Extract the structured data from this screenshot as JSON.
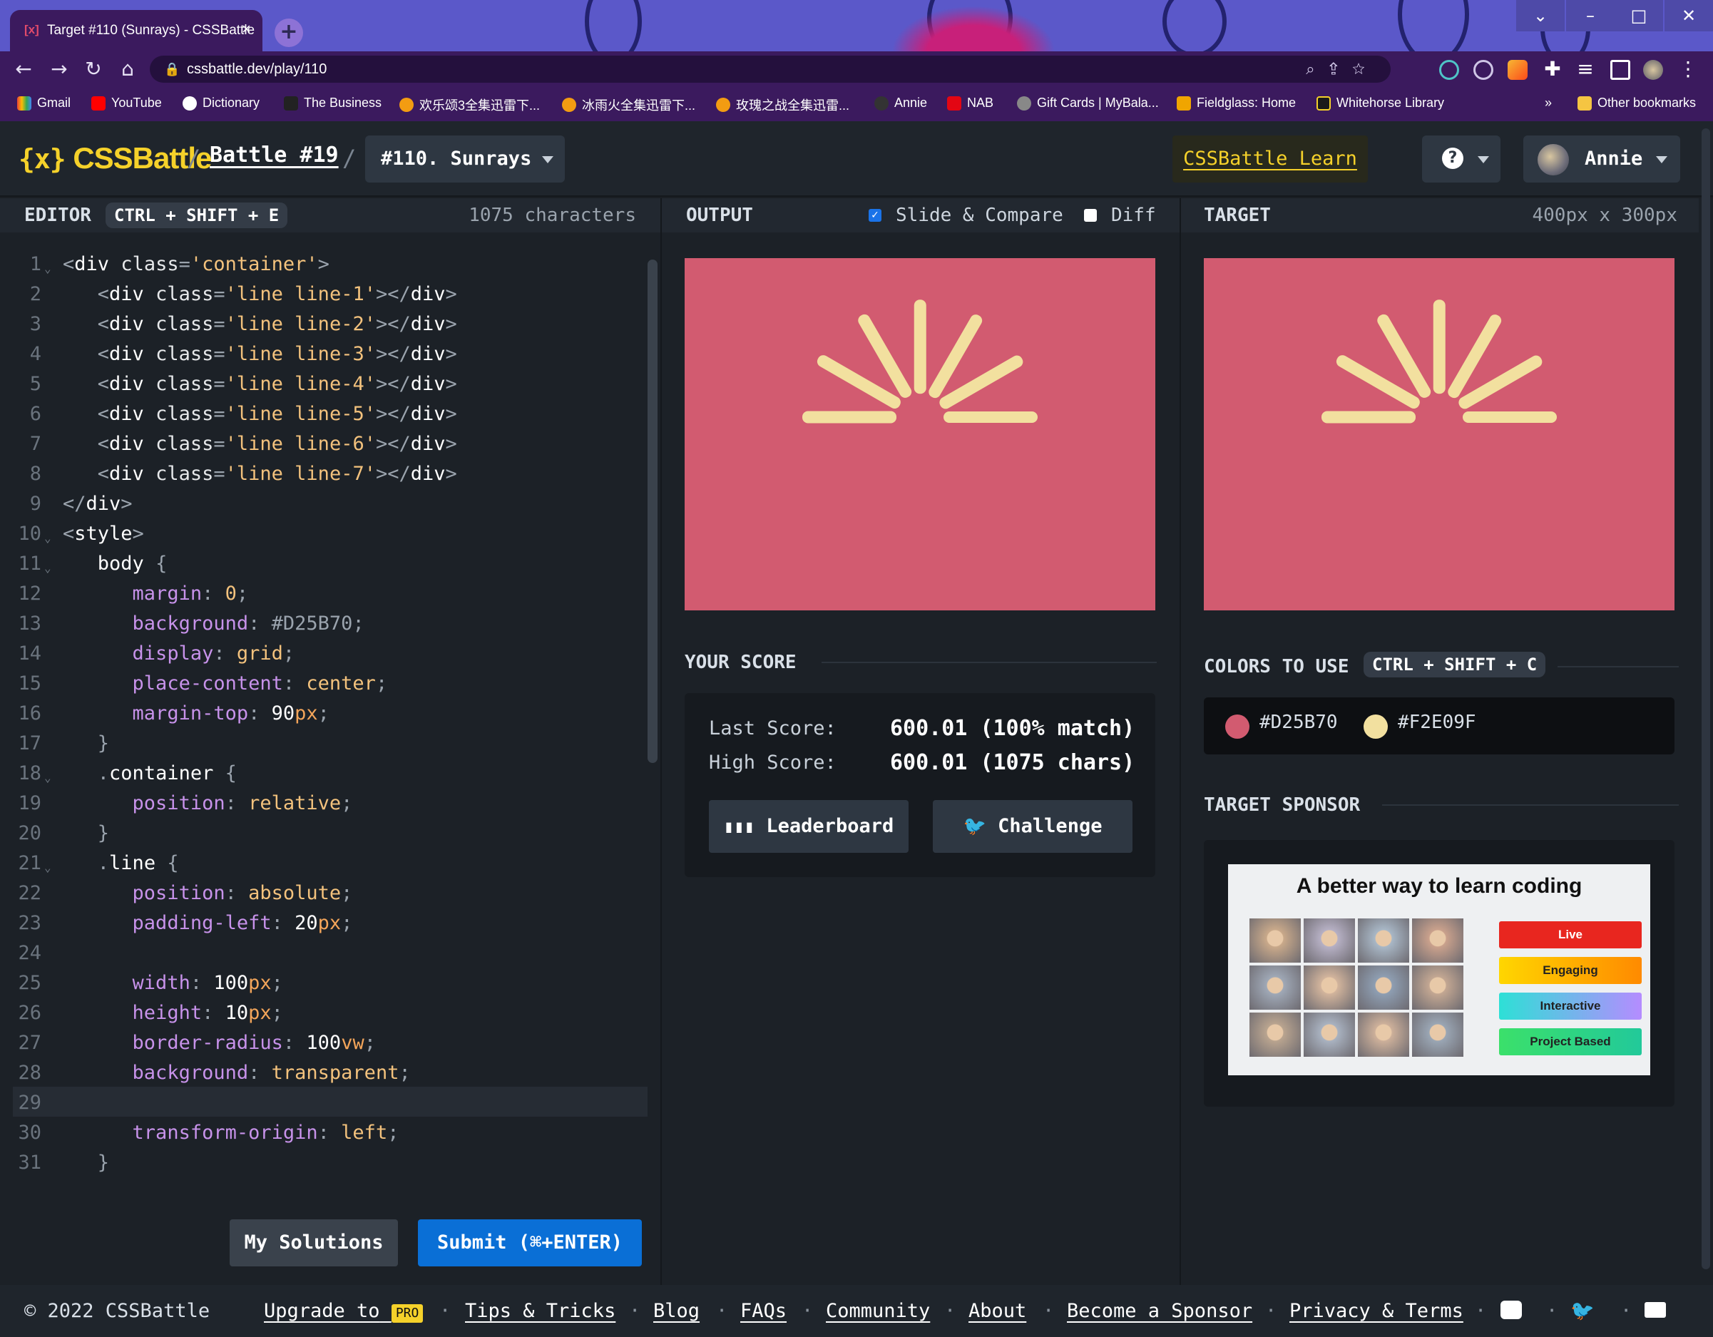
{
  "browser": {
    "tab_title": "Target #110 (Sunrays) - CSSBattle",
    "tab_icon": "[x]",
    "url": "cssbattle.dev/play/110",
    "bookmarks": [
      "Gmail",
      "YouTube",
      "Dictionary",
      "The Business",
      "欢乐颂3全集迅雷下...",
      "冰雨火全集迅雷下...",
      "玫瑰之战全集迅雷...",
      "Annie",
      "NAB",
      "Gift Cards | MyBala...",
      "Fieldglass: Home",
      "Whitehorse Library"
    ],
    "overflow": "»",
    "other_bookmarks": "Other bookmarks"
  },
  "header": {
    "logo": "CSSBattle",
    "logo_brackets": "{x}",
    "sep": "/",
    "battle_link": "Battle #19",
    "target_select": "#110. Sunrays",
    "learn_link": "CSSBattle Learn",
    "help_icon": "?",
    "user_name": "Annie"
  },
  "editor": {
    "label": "EDITOR",
    "shortcut": "CTRL + SHIFT + E",
    "char_count": "1075 characters",
    "my_solutions": "My Solutions",
    "submit": "Submit (⌘+ENTER)"
  },
  "code_lines": [
    {
      "n": "1",
      "t": "<div class='container'>"
    },
    {
      "n": "2",
      "t": "  <div class='line line-1'></div>"
    },
    {
      "n": "3",
      "t": "  <div class='line line-2'></div>"
    },
    {
      "n": "4",
      "t": "  <div class='line line-3'></div>"
    },
    {
      "n": "5",
      "t": "  <div class='line line-4'></div>"
    },
    {
      "n": "6",
      "t": "  <div class='line line-5'></div>"
    },
    {
      "n": "7",
      "t": "  <div class='line line-6'></div>"
    },
    {
      "n": "8",
      "t": "  <div class='line line-7'></div>"
    },
    {
      "n": "9",
      "t": "</div>"
    },
    {
      "n": "10",
      "t": "<style>"
    },
    {
      "n": "11",
      "t": "  body {"
    },
    {
      "n": "12",
      "t": "    margin: 0;"
    },
    {
      "n": "13",
      "t": "    background: #D25B70;"
    },
    {
      "n": "14",
      "t": "    display: grid;"
    },
    {
      "n": "15",
      "t": "    place-content: center;"
    },
    {
      "n": "16",
      "t": "    margin-top: 90px;"
    },
    {
      "n": "17",
      "t": "  }"
    },
    {
      "n": "18",
      "t": "  .container {"
    },
    {
      "n": "19",
      "t": "    position: relative;"
    },
    {
      "n": "20",
      "t": "  }"
    },
    {
      "n": "21",
      "t": "  .line {"
    },
    {
      "n": "22",
      "t": "    position: absolute;"
    },
    {
      "n": "23",
      "t": "    padding-left: 20px;"
    },
    {
      "n": "24",
      "t": ""
    },
    {
      "n": "25",
      "t": "    width: 100px;"
    },
    {
      "n": "26",
      "t": "    height: 10px;"
    },
    {
      "n": "27",
      "t": "    border-radius: 100vw;"
    },
    {
      "n": "28",
      "t": "    background: transparent;"
    },
    {
      "n": "29",
      "t": ""
    },
    {
      "n": "30",
      "t": "    transform-origin: left;"
    },
    {
      "n": "31",
      "t": "  }"
    }
  ],
  "output": {
    "label": "OUTPUT",
    "slide_compare": "Slide & Compare",
    "slide_compare_checked": true,
    "diff": "Diff",
    "diff_checked": false
  },
  "score": {
    "heading": "YOUR SCORE",
    "last_label": "Last Score:",
    "last_value": "600.01 (100% match)",
    "high_label": "High Score:",
    "high_value": "600.01 (1075 chars)",
    "leaderboard": "Leaderboard",
    "challenge": "Challenge"
  },
  "target": {
    "label": "TARGET",
    "size": "400px x 300px",
    "colors_heading": "COLORS TO USE",
    "colors_shortcut": "CTRL + SHIFT + C",
    "colors": [
      "#D25B70",
      "#F2E09F"
    ],
    "sponsor_heading": "TARGET SPONSOR",
    "ad_title": "A better way to learn coding",
    "ad_pills": [
      "Live",
      "Engaging",
      "Interactive",
      "Project Based"
    ]
  },
  "footer": {
    "copyright": "© 2022 CSSBattle",
    "links": [
      "Upgrade to",
      "Tips & Tricks",
      "Blog",
      "FAQs",
      "Community",
      "About",
      "Become a Sponsor",
      "Privacy & Terms"
    ],
    "pro_badge": "PRO",
    "sep": "·"
  }
}
